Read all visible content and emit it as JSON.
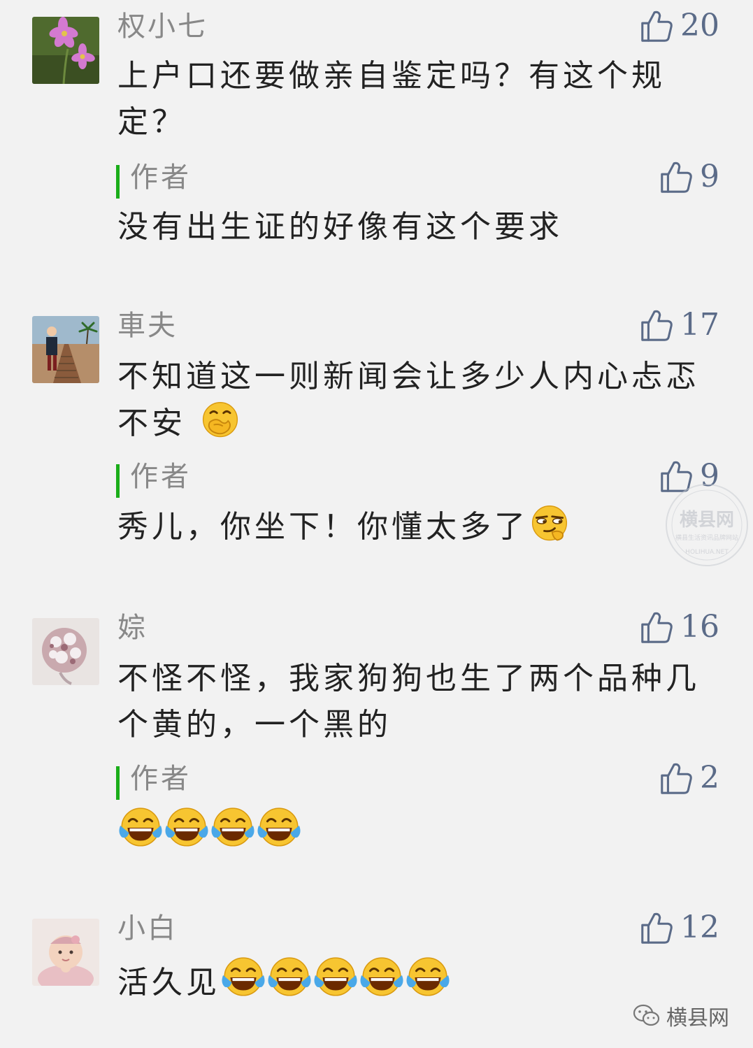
{
  "comments": [
    {
      "nickname": "权小七",
      "likes": "20",
      "text": "上户口还要做亲自鉴定吗？有这个规定？",
      "reply": {
        "label": "作者",
        "likes": "9",
        "text": "没有出生证的好像有这个要求"
      }
    },
    {
      "nickname": "車夫",
      "likes": "17",
      "text": "不知道这一则新闻会让多少人内心忐忑不安",
      "reply": {
        "label": "作者",
        "likes": "9",
        "text": "秀儿，你坐下！你懂太多了"
      }
    },
    {
      "nickname": "婃",
      "likes": "16",
      "text": "不怪不怪，我家狗狗也生了两个品种几个黄的，一个黑的",
      "reply": {
        "label": "作者",
        "likes": "2",
        "text": ""
      }
    },
    {
      "nickname": "小白",
      "likes": "12",
      "text": "活久见"
    }
  ],
  "watermark": {
    "title": "横县网",
    "subtitle": "横县生活资讯品牌网站",
    "url": "HOLIHUA.NET"
  },
  "footer": {
    "account": "横县网"
  },
  "icons": {
    "like": "thumbs-up-icon",
    "thinking": "hand-over-mouth-emoji",
    "smirk": "smirking-emoji",
    "laugh": "tears-of-joy-emoji",
    "wechat": "wechat-icon"
  },
  "colors": {
    "accent_bar": "#1aad19",
    "like": "#5b6b88",
    "background": "#f2f2f2"
  }
}
